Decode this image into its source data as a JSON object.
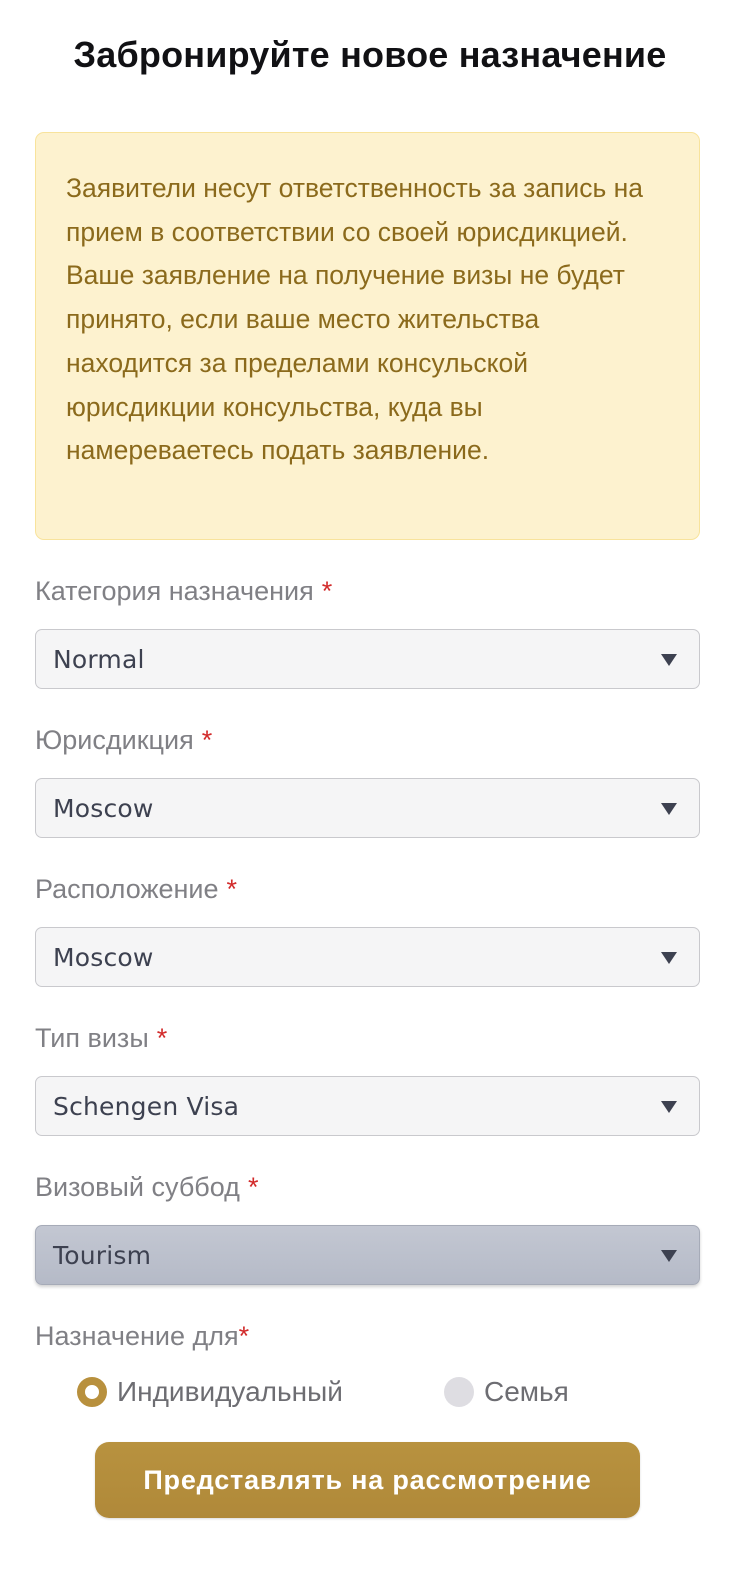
{
  "page": {
    "title": "Забронируйте новое назначение"
  },
  "notice": {
    "paragraphs": [
      "Заявители несут ответственность за запись на прием в соответствии со своей юрисдикцией.",
      "Ваше заявление на получение визы не будет принято, если ваше место жительства находится за пределами консульской юрисдикции консульства, куда вы намереваетесь подать заявление."
    ],
    "colors": {
      "background": "#fdf2cf",
      "border": "#f8e39c",
      "text": "#8b6a1c"
    }
  },
  "form": {
    "required_marker": "*",
    "fields": [
      {
        "label": "Категория назначения",
        "value": "Normal",
        "icon": "caret-down-icon"
      },
      {
        "label": "Юрисдикция",
        "value": "Moscow",
        "icon": "caret-down-icon"
      },
      {
        "label": "Расположение",
        "value": "Moscow",
        "icon": "caret-down-icon"
      },
      {
        "label": "Тип визы",
        "value": "Schengen Visa",
        "icon": "caret-down-icon"
      },
      {
        "label": "Визовый суббод",
        "value": "Tourism",
        "icon": "caret-down-icon",
        "focused": true
      }
    ],
    "appointment_for": {
      "label": "Назначение для",
      "options": [
        {
          "label": "Индивидуальный",
          "checked": true
        },
        {
          "label": "Семья",
          "checked": false
        }
      ]
    },
    "submit_label": "Представлять на рассмотрение"
  },
  "theme": {
    "accent": "#b8903d",
    "required": "#d22b2b",
    "label": "#808085",
    "title": "#111114"
  }
}
